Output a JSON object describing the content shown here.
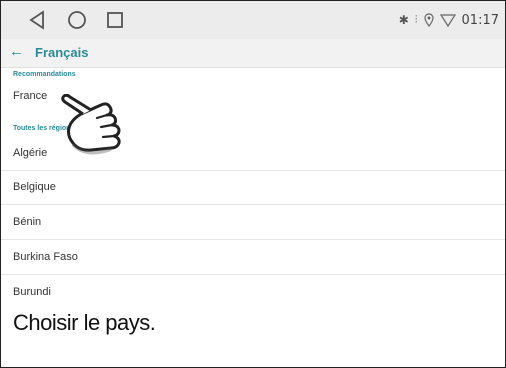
{
  "status": {
    "time": "01:17",
    "icons": [
      "bluetooth-icon",
      "vibrate-icon",
      "location-icon",
      "wifi-icon"
    ]
  },
  "navbar": {
    "buttons": [
      "back-triangle-icon",
      "home-circle-icon",
      "recents-square-icon"
    ]
  },
  "appbar": {
    "back_icon": "←",
    "title": "Français"
  },
  "list": {
    "section_recommended": "Recommandations",
    "recommended": [
      "France"
    ],
    "section_all": "Toutes les régions",
    "regions": [
      "Algérie",
      "Belgique",
      "Bénin",
      "Burkina Faso",
      "Burundi"
    ]
  },
  "caption": "Choisir le pays.",
  "colors": {
    "accent": "#2a8a99",
    "statusbar": "#ececec",
    "appbar": "#f2f2f2"
  }
}
